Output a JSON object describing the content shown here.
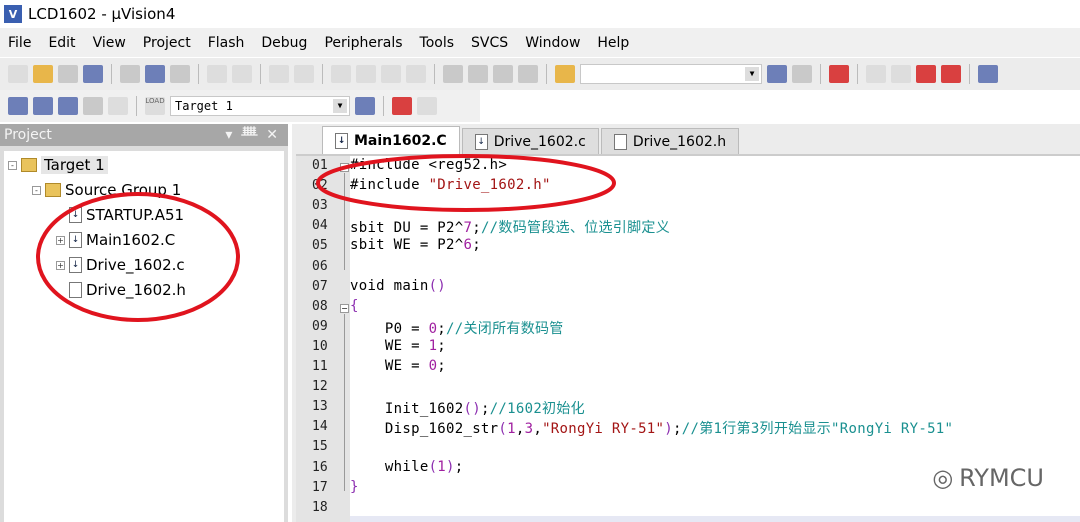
{
  "window": {
    "title": "LCD1602  - µVision4",
    "icon": "uvision-icon"
  },
  "menu": [
    "File",
    "Edit",
    "View",
    "Project",
    "Flash",
    "Debug",
    "Peripherals",
    "Tools",
    "SVCS",
    "Window",
    "Help"
  ],
  "toolbar": {
    "target_select": "Target 1",
    "load_label": "LOAD"
  },
  "project": {
    "title": "Project",
    "tree": [
      {
        "label": "Target 1",
        "type": "target",
        "level": 0,
        "expander": "-"
      },
      {
        "label": "Source Group 1",
        "type": "folder",
        "level": 1,
        "expander": "-"
      },
      {
        "label": "STARTUP.A51",
        "type": "file",
        "level": 2,
        "expander": ""
      },
      {
        "label": "Main1602.C",
        "type": "file",
        "level": 2,
        "expander": "+"
      },
      {
        "label": "Drive_1602.c",
        "type": "file",
        "level": 2,
        "expander": "+"
      },
      {
        "label": "Drive_1602.h",
        "type": "header",
        "level": 2,
        "expander": ""
      }
    ]
  },
  "editor": {
    "tabs": [
      {
        "label": "Main1602.C",
        "active": true
      },
      {
        "label": "Drive_1602.c",
        "active": false
      },
      {
        "label": "Drive_1602.h",
        "active": false
      }
    ],
    "lines": [
      [
        [
          "h",
          "#include <reg52.h>"
        ]
      ],
      [
        [
          "h",
          "#include "
        ],
        [
          "s",
          "\"Drive_1602.h\""
        ]
      ],
      [],
      [
        [
          "k",
          "sbit DU = P2^"
        ],
        [
          "n",
          "7"
        ],
        [
          "k",
          ";"
        ],
        [
          "c",
          "//数码管段选、位选引脚定义"
        ]
      ],
      [
        [
          "k",
          "sbit WE = P2^"
        ],
        [
          "n",
          "6"
        ],
        [
          "k",
          ";"
        ]
      ],
      [],
      [
        [
          "k",
          "void main"
        ],
        [
          "p",
          "()"
        ]
      ],
      [
        [
          "p",
          "{"
        ]
      ],
      [
        [
          "k",
          "    P0 = "
        ],
        [
          "n",
          "0"
        ],
        [
          "k",
          ";"
        ],
        [
          "c",
          "//关闭所有数码管"
        ]
      ],
      [
        [
          "k",
          "    WE = "
        ],
        [
          "n",
          "1"
        ],
        [
          "k",
          ";"
        ]
      ],
      [
        [
          "k",
          "    WE = "
        ],
        [
          "n",
          "0"
        ],
        [
          "k",
          ";"
        ]
      ],
      [],
      [
        [
          "k",
          "    Init_1602"
        ],
        [
          "p",
          "()"
        ],
        [
          "k",
          ";"
        ],
        [
          "c",
          "//1602初始化"
        ]
      ],
      [
        [
          "k",
          "    Disp_1602_str"
        ],
        [
          "p",
          "("
        ],
        [
          "n",
          "1"
        ],
        [
          "k",
          ","
        ],
        [
          "n",
          "3"
        ],
        [
          "k",
          ","
        ],
        [
          "s",
          "\"RongYi RY-51\""
        ],
        [
          "p",
          ")"
        ],
        [
          "k",
          ";"
        ],
        [
          "c",
          "//第1行第3列开始显示\"RongYi RY-51\""
        ]
      ],
      [],
      [
        [
          "k",
          "    while"
        ],
        [
          "p",
          "("
        ],
        [
          "n",
          "1"
        ],
        [
          "p",
          ")"
        ],
        [
          "k",
          ";"
        ]
      ],
      [
        [
          "p",
          "}"
        ]
      ],
      []
    ]
  },
  "watermark": "RYMCU",
  "colors": {
    "annotation": "#e0141e",
    "comment": "#1a9090",
    "string": "#a31515",
    "number": "#a020a0"
  }
}
